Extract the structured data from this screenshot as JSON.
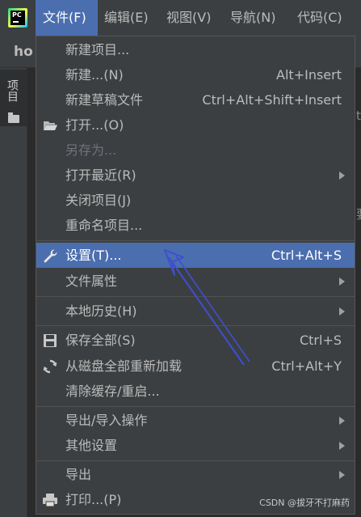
{
  "app": {
    "logo_text": "PC"
  },
  "menubar": {
    "file": "文件(F)",
    "edit": "编辑(E)",
    "view": "视图(V)",
    "navigate": "导航(N)",
    "code": "代码(C)"
  },
  "navbar": {
    "crumb": "ho"
  },
  "tool_window": {
    "project_label": "项目"
  },
  "editor_fragments": {
    "t": "t",
    "ra": "要"
  },
  "menu": {
    "new_project": "新建项目...",
    "new": {
      "label": "新建...(N)",
      "shortcut": "Alt+Insert"
    },
    "new_scratch": {
      "label": "新建草稿文件",
      "shortcut": "Ctrl+Alt+Shift+Insert"
    },
    "open": "打开...(O)",
    "save_as": "另存为...",
    "open_recent": "打开最近(R)",
    "close_project": "关闭项目(J)",
    "rename_project": "重命名项目...",
    "settings": {
      "label": "设置(T)...",
      "shortcut": "Ctrl+Alt+S"
    },
    "file_properties": "文件属性",
    "local_history": "本地历史(H)",
    "save_all": {
      "label": "保存全部(S)",
      "shortcut": "Ctrl+S"
    },
    "reload_all": {
      "label": "从磁盘全部重新加载",
      "shortcut": "Ctrl+Alt+Y"
    },
    "invalidate_caches": "清除缓存/重启...",
    "import_export": "导出/导入操作",
    "other_settings": "其他设置",
    "export": "导出",
    "print": "打印...(P)"
  },
  "watermark": "CSDN @拔牙不打麻药",
  "colors": {
    "menubar_bg": "#3c3f41",
    "selection": "#4b6eaf",
    "annotation_arrow": "#3d4fd0"
  }
}
